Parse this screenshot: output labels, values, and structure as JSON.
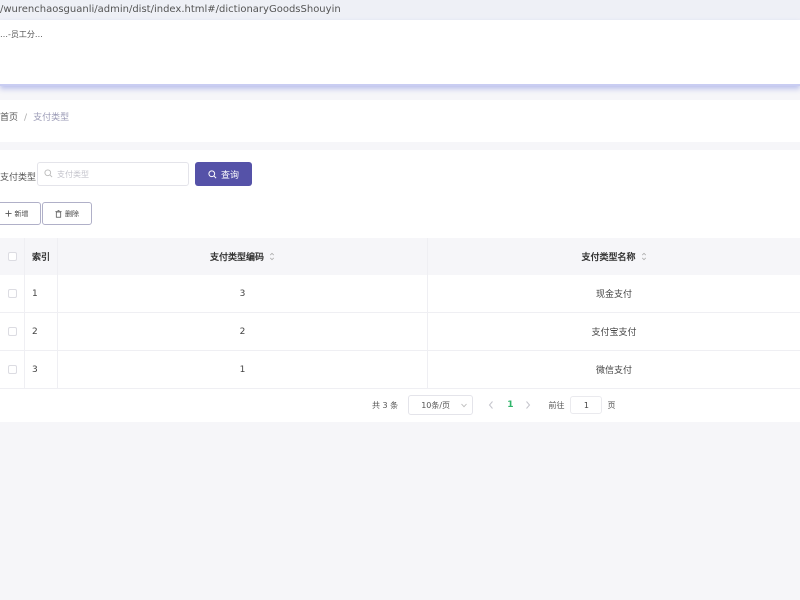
{
  "browser": {
    "url": "/wurenchaosguanli/admin/dist/index.html#/dictionaryGoodsShouyin"
  },
  "header": {
    "text": "…-员工分…"
  },
  "breadcrumb": {
    "home": "首页",
    "separator": "/",
    "current": "支付类型"
  },
  "filter": {
    "label": "支付类型",
    "placeholder": "支付类型",
    "query_label": "查询"
  },
  "actions": {
    "add_label": "新增",
    "delete_label": "删除"
  },
  "table": {
    "columns": {
      "index": "索引",
      "code": "支付类型编码",
      "name": "支付类型名称"
    },
    "rows": [
      {
        "index": "1",
        "code": "3",
        "name": "现金支付"
      },
      {
        "index": "2",
        "code": "2",
        "name": "支付宝支付"
      },
      {
        "index": "3",
        "code": "1",
        "name": "微信支付"
      }
    ]
  },
  "pagination": {
    "total": "共 3 条",
    "page_size": "10条/页",
    "current_page": "1",
    "goto_label": "前往",
    "goto_value": "1",
    "page_label": "页"
  },
  "colors": {
    "primary": "#5552a8",
    "active_page": "#2fb56a",
    "background": "#f6f6f9"
  }
}
